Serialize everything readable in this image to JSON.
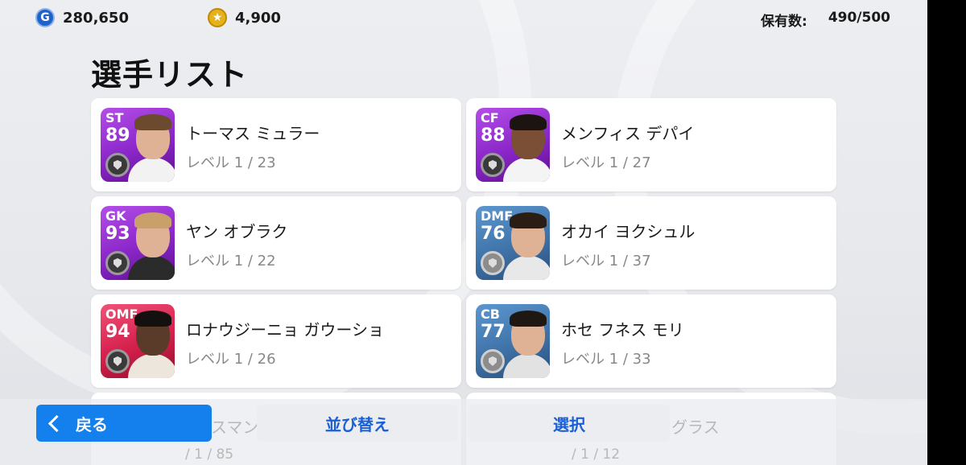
{
  "currency": {
    "gp_icon": "G",
    "gp_value": "280,650",
    "coins_value": "4,900"
  },
  "owned": {
    "label": "保有数:",
    "value": "490/500"
  },
  "title": "選手リスト",
  "players": [
    {
      "pos": "ST",
      "ovr": "89",
      "name": "トーマス ミュラー",
      "level": "レベル 1 / 23",
      "color": "purple",
      "badge": "dark"
    },
    {
      "pos": "CF",
      "ovr": "88",
      "name": "メンフィス デパイ",
      "level": "レベル 1 / 27",
      "color": "purple",
      "badge": "dark"
    },
    {
      "pos": "GK",
      "ovr": "93",
      "name": "ヤン オブラク",
      "level": "レベル 1 / 22",
      "color": "purple",
      "badge": "dark"
    },
    {
      "pos": "DMF",
      "ovr": "76",
      "name": "オカイ ヨクシュル",
      "level": "レベル 1 / 37",
      "color": "blue",
      "badge": "silver"
    },
    {
      "pos": "OMF",
      "ovr": "94",
      "name": "ロナウジーニョ ガウーショ",
      "level": "レベル 1 / 26",
      "color": "pink",
      "badge": "dark"
    },
    {
      "pos": "CB",
      "ovr": "77",
      "name": "ホセ フネス モリ",
      "level": "レベル 1 / 33",
      "color": "blue",
      "badge": "silver"
    }
  ],
  "partial": {
    "left_name": "スマン",
    "left_level": "/ 1 / 85",
    "right_name": "グラス",
    "right_level": "/ 1 / 12"
  },
  "buttons": {
    "back": "戻る",
    "sort": "並び替え",
    "select": "選択"
  }
}
